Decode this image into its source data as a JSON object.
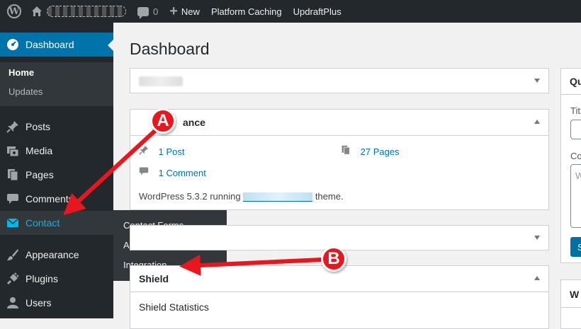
{
  "adminbar": {
    "comments_count": "0",
    "new_label": "New",
    "platform_caching": "Platform Caching",
    "updraftplus": "UpdraftPlus"
  },
  "sidebar": {
    "dashboard": "Dashboard",
    "home": "Home",
    "updates": "Updates",
    "posts": "Posts",
    "media": "Media",
    "pages": "Pages",
    "comments": "Comments",
    "contact": "Contact",
    "appearance": "Appearance",
    "plugins": "Plugins",
    "users": "Users"
  },
  "flyout": {
    "items": [
      "Contact Forms",
      "Add New",
      "Integration"
    ]
  },
  "main": {
    "title": "Dashboard",
    "at_a_glance": {
      "title_partial": "ance",
      "posts": "1 Post",
      "pages": "27 Pages",
      "comments": "1 Comment",
      "running_prefix": "WordPress 5.3.2 running",
      "running_suffix": "theme."
    },
    "shield": {
      "title": "Shield",
      "statistics": "Shield Statistics"
    }
  },
  "right_column": {
    "quick_draft_partial": "Qu",
    "title_label_partial": "Titl",
    "content_label_partial": "Co",
    "content_placeholder_partial": "W",
    "save_partial": "S",
    "widget_partial": "W"
  },
  "annotations": {
    "a": "A",
    "b": "B",
    "color": "#e8171f"
  },
  "colors": {
    "admin_dark": "#23282d",
    "accent_blue": "#0073aa",
    "contact_highlight": "#00b9eb"
  }
}
